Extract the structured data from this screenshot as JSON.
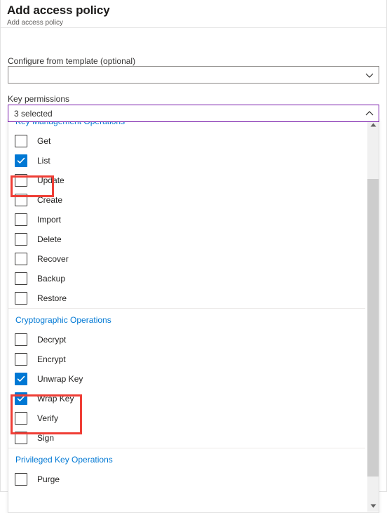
{
  "header": {
    "title": "Add access policy",
    "subtitle": "Add access policy"
  },
  "form": {
    "template_label": "Configure from template (optional)",
    "template_value": "",
    "template_placeholder": "",
    "key_permissions_label": "Key permissions",
    "key_permissions_value": "3 selected",
    "expand_icon": "chevron-up-icon",
    "collapse_icon": "chevron-down-icon"
  },
  "dropdown": {
    "groups": [
      {
        "header": "Key Management Operations",
        "options": [
          {
            "label": "Get",
            "checked": false
          },
          {
            "label": "List",
            "checked": true
          },
          {
            "label": "Update",
            "checked": false
          },
          {
            "label": "Create",
            "checked": false
          },
          {
            "label": "Import",
            "checked": false
          },
          {
            "label": "Delete",
            "checked": false
          },
          {
            "label": "Recover",
            "checked": false
          },
          {
            "label": "Backup",
            "checked": false
          },
          {
            "label": "Restore",
            "checked": false
          }
        ]
      },
      {
        "header": "Cryptographic Operations",
        "options": [
          {
            "label": "Decrypt",
            "checked": false
          },
          {
            "label": "Encrypt",
            "checked": false
          },
          {
            "label": "Unwrap Key",
            "checked": true
          },
          {
            "label": "Wrap Key",
            "checked": true
          },
          {
            "label": "Verify",
            "checked": false
          },
          {
            "label": "Sign",
            "checked": false
          }
        ]
      },
      {
        "header": "Privileged Key Operations",
        "options": [
          {
            "label": "Purge",
            "checked": false
          }
        ]
      }
    ]
  },
  "scrollbar": {
    "up_icon": "scroll-up-arrow-icon",
    "down_icon": "scroll-down-arrow-icon"
  },
  "annotations": [
    {
      "name": "highlight-list",
      "target": "List"
    },
    {
      "name": "highlight-wrap-keys",
      "target": "Unwrap Key, Wrap Key"
    }
  ],
  "colors": {
    "accent": "#0078d4",
    "focus_border": "#7719aa",
    "annotation": "#ef3e36",
    "group_header": "#0078d4"
  }
}
